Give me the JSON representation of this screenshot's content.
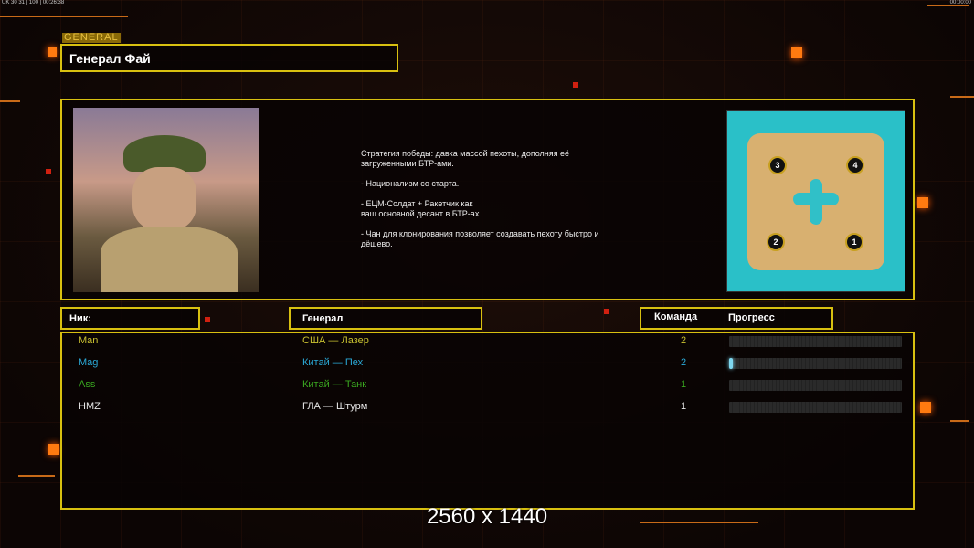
{
  "status_bar": {
    "left": "UK 30 31 | 100 | 00:26:38",
    "right": "00:00:00"
  },
  "general_label": "GENERAL",
  "title": "Генерал Фай",
  "description": "Стратегия победы: давка массой пехоты, дополняя её\n загруженными БТР-ами.\n\n- Национализм со старта.\n\n- ЕЦМ-Солдат + Ракетчик как\nваш основной десант в БТР-ах.\n\n- Чан для клонирования позволяет создавать пехоту быстро и\n дёшево.",
  "map": {
    "start_positions": [
      "1",
      "2",
      "3",
      "4"
    ]
  },
  "columns": {
    "nick": "Ник:",
    "general": "Генерал",
    "team": "Команда",
    "progress": "Прогресс"
  },
  "players": [
    {
      "nick": "Man",
      "general": "США — Лазер",
      "team": "2",
      "progress": 0,
      "color": "#c8c030"
    },
    {
      "nick": "Mag",
      "general": "Китай — Пех",
      "team": "2",
      "progress": 0.02,
      "color": "#2aaad8"
    },
    {
      "nick": "Ass",
      "general": "Китай — Танк",
      "team": "1",
      "progress": 0,
      "color": "#3aa820"
    },
    {
      "nick": "HMZ",
      "general": "ГЛА — Штурм",
      "team": "1",
      "progress": 0,
      "color": "#e8e8e8"
    }
  ],
  "watermark": "2560 x 1440"
}
